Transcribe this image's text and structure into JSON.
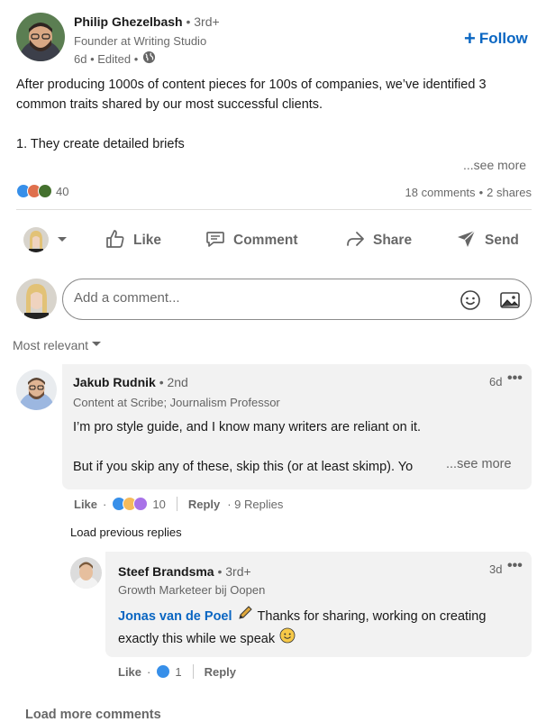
{
  "post": {
    "author": {
      "name": "Philip Ghezelbash",
      "degree": "• 3rd+",
      "headline": "Founder at Writing Studio",
      "meta": "6d • Edited •"
    },
    "follow_label": "Follow",
    "body_line1": "After producing 1000s of content pieces for 100s of companies, we’ve identified 3",
    "body_line2": "common traits shared by our most successful clients.",
    "body_line3": "1. They create detailed briefs",
    "see_more": "...see more",
    "reaction_count": "40",
    "comments_count": "18 comments",
    "shares_sep": "•",
    "shares_count": "2 shares"
  },
  "actions": {
    "like": "Like",
    "comment": "Comment",
    "share": "Share",
    "send": "Send"
  },
  "comment_input": {
    "placeholder": "Add a comment..."
  },
  "sort": {
    "label": "Most relevant"
  },
  "comments": [
    {
      "name": "Jakub Rudnik",
      "degree": "• 2nd",
      "headline": "Content at Scribe; Journalism Professor",
      "time": "6d",
      "line1": "I’m pro style guide, and I know many writers are reliant on it.",
      "line2": "But if you skip any of these, skip this (or at least skimp). Yo",
      "see_more": "...see more",
      "like": "Like",
      "dot": "·",
      "reaction_count": "10",
      "reply": "Reply",
      "replies": "· 9 Replies"
    }
  ],
  "load_previous": "Load previous replies",
  "reply": {
    "name": "Steef Brandsma",
    "degree": "• 3rd+",
    "headline": "Growth Marketeer bij Oopen",
    "time": "3d",
    "mention": "Jonas van de Poel",
    "text_part1": "Thanks for sharing, working on creating",
    "text_line2": "exactly this while we speak",
    "like": "Like",
    "dot": "·",
    "reaction_count": "1",
    "reply_label": "Reply"
  },
  "load_more": "Load more comments",
  "colors": {
    "brand_blue": "#0a66c2",
    "bubble_bg": "#f2f2f2",
    "like_blue": "#378fe9",
    "celebrate_green": "#44712e",
    "love_red": "#df704d",
    "insight_yellow": "#f5bb5c"
  },
  "icons": {
    "globe": "globe-icon",
    "like": "thumbs-up-icon",
    "comment": "speech-bubble-icon",
    "share": "share-arrow-icon",
    "send": "paper-plane-icon",
    "emoji": "smiley-icon",
    "image": "image-icon",
    "more": "ellipsis-icon",
    "pencil": "pencil-emoji",
    "smile": "smile-emoji"
  }
}
